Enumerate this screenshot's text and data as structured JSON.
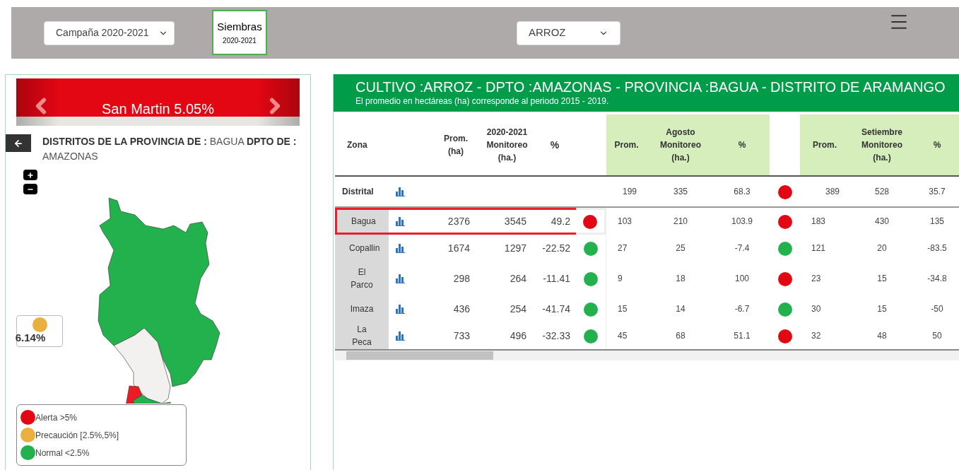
{
  "toolbar": {
    "campaign_select": "Campaña 2020-2021",
    "siembras": {
      "title": "Siembras",
      "subtitle": "2020-2021"
    },
    "crop_select": "ARROZ"
  },
  "carousel": {
    "label": "San Martin 5.05%"
  },
  "map_panel": {
    "heading": "**DISTRITOS DE LA PROVINCIA DE :** BAGUA **DPTO DE :** AMAZONAS",
    "tooltip": {
      "value": "6.14%",
      "color": "#e9b040"
    },
    "legend": [
      {
        "label": "Alerta >5%",
        "color": "#e30613"
      },
      {
        "label": "Precaución [2.5%,5%]",
        "color": "#e9b040"
      },
      {
        "label": "Normal <2.5%",
        "color": "#22b14c"
      }
    ]
  },
  "report": {
    "title": "CULTIVO :ARROZ - DPTO :AMAZONAS - PROVINCIA :BAGUA - DISTRITO DE ARAMANGO",
    "subtitle": "El promedio en hectáreas (ha) corresponde al periodo 2015 - 2019.",
    "columns": {
      "zona": "Zona",
      "prom": "Prom. (ha)",
      "monitoreo": "2020-2021 Monitoreo (ha.)",
      "pct": "%"
    },
    "months": [
      {
        "month": "Agosto",
        "prom": "Prom.",
        "monitoreo": "Monitoreo (ha.)",
        "pct": "%"
      },
      {
        "month": "Setiembre",
        "prom": "Prom.",
        "monitoreo": "Monitoreo (ha.)",
        "pct": "%"
      }
    ],
    "rows": [
      {
        "kind": "total",
        "zona": "Distrital",
        "selected": false,
        "months": [
          {
            "prom": "199",
            "monitoreo": "335",
            "pct": "68.3",
            "color": "#e30613"
          },
          {
            "prom": "389",
            "monitoreo": "528",
            "pct": "35.7"
          }
        ]
      },
      {
        "kind": "district",
        "zona": "Bagua",
        "selected": true,
        "prom": "2376",
        "monitoreo": "3545",
        "pct": "49.2",
        "color": "#e30613",
        "months": [
          {
            "prom": "103",
            "monitoreo": "210",
            "pct": "103.9",
            "color": "#e30613"
          },
          {
            "prom": "183",
            "monitoreo": "430",
            "pct": "135"
          }
        ]
      },
      {
        "kind": "district",
        "zona": "Copallin",
        "selected": false,
        "prom": "1674",
        "monitoreo": "1297",
        "pct": "-22.52",
        "color": "#22b14c",
        "months": [
          {
            "prom": "27",
            "monitoreo": "25",
            "pct": "-7.4",
            "color": "#22b14c"
          },
          {
            "prom": "121",
            "monitoreo": "20",
            "pct": "-83.5"
          }
        ]
      },
      {
        "kind": "district",
        "zona": "El Parco",
        "selected": false,
        "prom": "298",
        "monitoreo": "264",
        "pct": "-11.41",
        "color": "#22b14c",
        "months": [
          {
            "prom": "9",
            "monitoreo": "18",
            "pct": "100",
            "color": "#e30613"
          },
          {
            "prom": "23",
            "monitoreo": "15",
            "pct": "-34.8"
          }
        ]
      },
      {
        "kind": "district",
        "zona": "Imaza",
        "selected": false,
        "prom": "436",
        "monitoreo": "254",
        "pct": "-41.74",
        "color": "#22b14c",
        "months": [
          {
            "prom": "15",
            "monitoreo": "14",
            "pct": "-6.7",
            "color": "#22b14c"
          },
          {
            "prom": "30",
            "monitoreo": "15",
            "pct": "-50"
          }
        ]
      },
      {
        "kind": "district",
        "zona": "La Peca",
        "selected": false,
        "prom": "733",
        "monitoreo": "496",
        "pct": "-32.33",
        "color": "#22b14c",
        "months": [
          {
            "prom": "45",
            "monitoreo": "68",
            "pct": "51.1",
            "color": "#e30613"
          },
          {
            "prom": "32",
            "monitoreo": "48",
            "pct": "50"
          }
        ]
      }
    ]
  }
}
